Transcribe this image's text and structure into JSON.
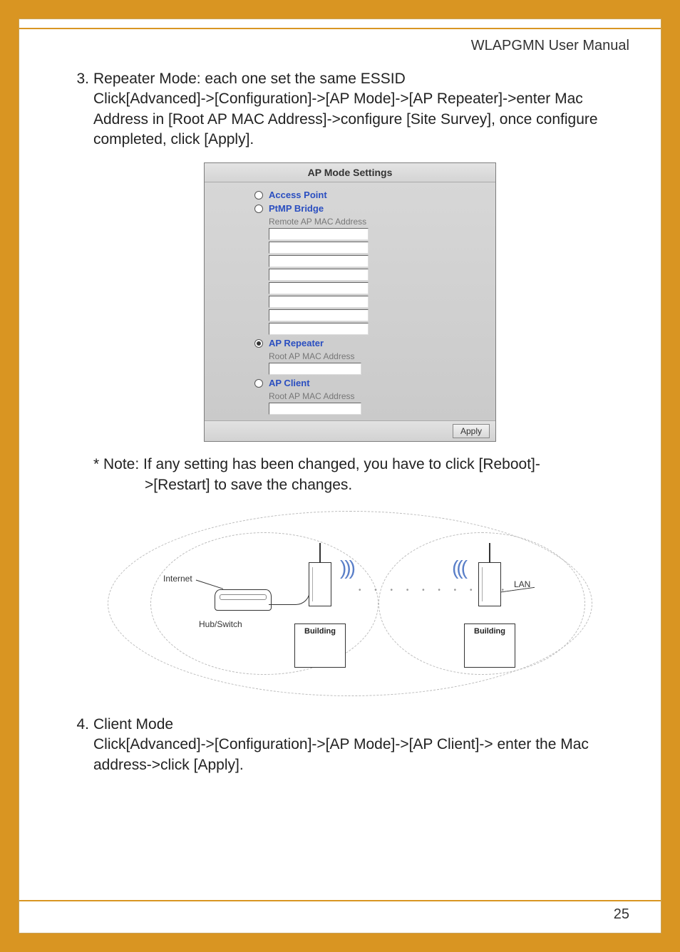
{
  "header": {
    "title": "WLAPGMN User Manual"
  },
  "item3": {
    "number": "3.",
    "line1": "Repeater Mode: each one set the same ESSID",
    "line2": "Click[Advanced]->[Configuration]->[AP Mode]->[AP Repeater]->enter Mac Address in [Root AP MAC Address]->configure [Site Survey], once configure completed, click [Apply]."
  },
  "ap_panel": {
    "title": "AP Mode Settings",
    "opt_access_point": "Access Point",
    "opt_ptmp": "PtMP Bridge",
    "remote_label": "Remote AP MAC Address",
    "opt_repeater": "AP Repeater",
    "root_label": "Root AP MAC Address",
    "opt_client": "AP Client",
    "client_root_label": "Root AP MAC Address",
    "apply": "Apply",
    "selected": "repeater"
  },
  "note": {
    "line1": "* Note: If any setting has been changed, you have to click [Reboot]-",
    "line2": ">[Restart] to save the changes."
  },
  "diagram": {
    "internet": "Internet",
    "hub": "Hub/Switch",
    "building": "Building",
    "lan": "LAN"
  },
  "item4": {
    "number": "4.",
    "line1": "Client Mode",
    "line2": "Click[Advanced]->[Configuration]->[AP Mode]->[AP Client]-> enter the Mac address->click [Apply]."
  },
  "footer": {
    "page": "25"
  }
}
